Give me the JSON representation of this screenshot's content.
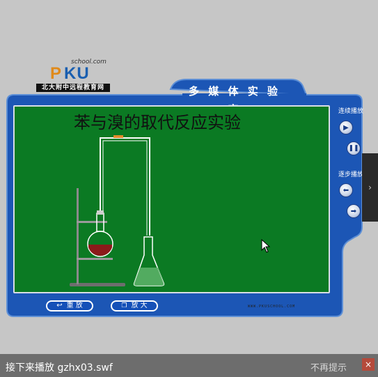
{
  "logo": {
    "site": "school.com",
    "brand_p": "P",
    "brand_ku": "KU",
    "tagline": "北大附中远程教育网"
  },
  "title": "多 媒 体 实 验 室",
  "experiment": {
    "title": "苯与溴的取代反应实验"
  },
  "controls": {
    "continuous_label": "连续播放",
    "play_icon": "play-icon",
    "pause_icon": "pause-icon",
    "step_label": "逐步播放",
    "prev_icon": "arrow-left-icon",
    "next_icon": "arrow-right-icon"
  },
  "buttons": {
    "replay_label": "重 放",
    "enlarge_label": "放 大"
  },
  "website": "WWW.PKUSCHOOL.COM",
  "bottom_bar": {
    "next_text": "接下来播放 gzhx03.swf",
    "no_show_label": "不再提示",
    "close_symbol": "×"
  },
  "colors": {
    "frame_blue": "#1c56b5",
    "board_green": "#0b7a23",
    "background_gray": "#c6c6c6",
    "flask_liquid": "#8b1a1a"
  }
}
